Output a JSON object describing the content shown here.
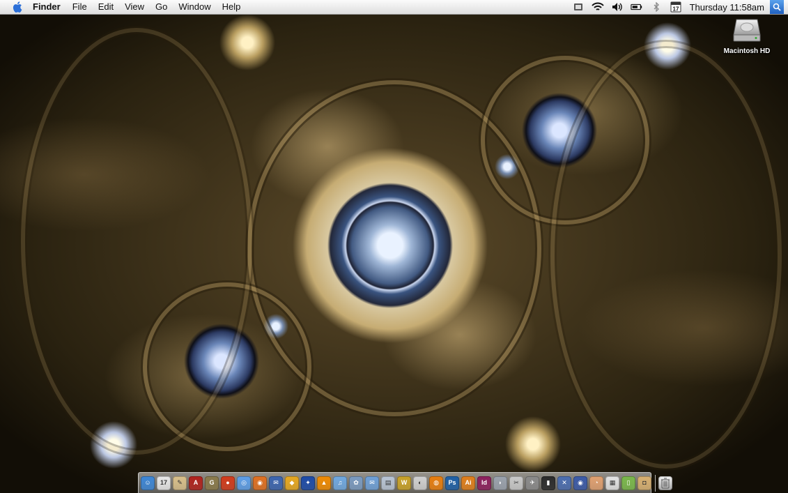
{
  "menubar": {
    "app_name": "Finder",
    "menus": [
      "File",
      "Edit",
      "View",
      "Go",
      "Window",
      "Help"
    ],
    "calendar_date": "17",
    "clock": "Thursday 11:58am",
    "status_icons": [
      "script-menu-icon",
      "wifi-icon",
      "volume-icon",
      "battery-icon",
      "bluetooth-icon",
      "ical-icon",
      "spotlight-icon"
    ]
  },
  "desktop": {
    "volume_label": "Macintosh HD"
  },
  "dock": {
    "apps": [
      {
        "name": "finder",
        "color": "#3c86d6",
        "glyph": "☺"
      },
      {
        "name": "ical",
        "color": "#e9e9e9",
        "glyph": "17"
      },
      {
        "name": "textedit",
        "color": "#d9c08a",
        "glyph": "✎"
      },
      {
        "name": "acrobat",
        "color": "#b0211c",
        "glyph": "A"
      },
      {
        "name": "gimp",
        "color": "#8a7a4a",
        "glyph": "G"
      },
      {
        "name": "game",
        "color": "#d23a1a",
        "glyph": "●"
      },
      {
        "name": "safari",
        "color": "#5c9ee8",
        "glyph": "◎"
      },
      {
        "name": "firefox",
        "color": "#e07020",
        "glyph": "◉"
      },
      {
        "name": "thunderbird",
        "color": "#3a64b0",
        "glyph": "✉"
      },
      {
        "name": "transmit",
        "color": "#e7a81f",
        "glyph": "◆"
      },
      {
        "name": "cyberduck",
        "color": "#1b4aa8",
        "glyph": "✦"
      },
      {
        "name": "vlc",
        "color": "#f08a00",
        "glyph": "▲"
      },
      {
        "name": "itunes",
        "color": "#6fa8e0",
        "glyph": "♫"
      },
      {
        "name": "adium",
        "color": "#7a9ac0",
        "glyph": "✿"
      },
      {
        "name": "mail",
        "color": "#6ea0d8",
        "glyph": "✉"
      },
      {
        "name": "preview",
        "color": "#b8c4d4",
        "glyph": "▤"
      },
      {
        "name": "wordpress",
        "color": "#c9a227",
        "glyph": "W"
      },
      {
        "name": "cinema4d",
        "color": "#d0d0d0",
        "glyph": "◐"
      },
      {
        "name": "blender",
        "color": "#e87d0d",
        "glyph": "◍"
      },
      {
        "name": "photoshop",
        "color": "#1d5fa6",
        "glyph": "Ps"
      },
      {
        "name": "illustrator",
        "color": "#e07e1a",
        "glyph": "Ai"
      },
      {
        "name": "indesign",
        "color": "#8d1e5d",
        "glyph": "Id"
      },
      {
        "name": "utility-1",
        "color": "#9aa2ad",
        "glyph": "◗"
      },
      {
        "name": "utility-2",
        "color": "#c9c9c9",
        "glyph": "✂"
      },
      {
        "name": "utility-3",
        "color": "#8a8a8a",
        "glyph": "✈"
      },
      {
        "name": "terminal",
        "color": "#2a2a2a",
        "glyph": "▮"
      },
      {
        "name": "utility-4",
        "color": "#4a6db0",
        "glyph": "✕"
      },
      {
        "name": "utility-5",
        "color": "#3a5aa8",
        "glyph": "◉"
      },
      {
        "name": "utility-6",
        "color": "#e0a070",
        "glyph": "◔"
      },
      {
        "name": "utility-7",
        "color": "#e4e4e4",
        "glyph": "▦"
      },
      {
        "name": "utility-8",
        "color": "#7ab84a",
        "glyph": "▯"
      },
      {
        "name": "utility-9",
        "color": "#d8b070",
        "glyph": "◘"
      }
    ],
    "trash_label": "trash-icon"
  }
}
